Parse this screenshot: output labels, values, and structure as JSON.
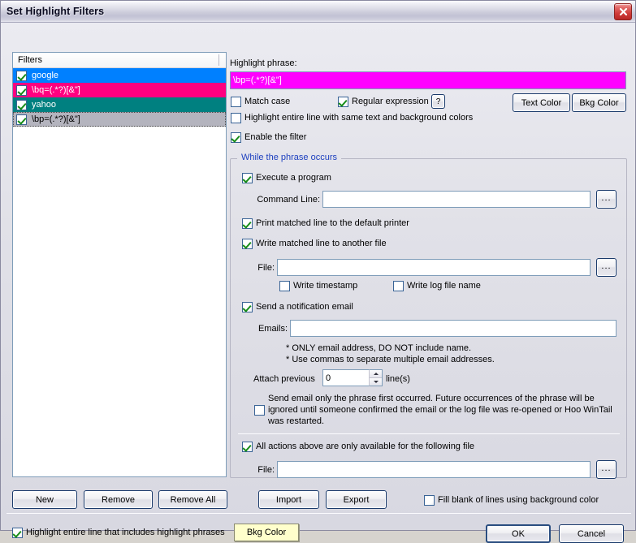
{
  "window": {
    "title": "Set Highlight Filters",
    "close_label": "×"
  },
  "filter_list": {
    "header": "Filters",
    "items": [
      {
        "label": "google",
        "checked": true,
        "bg": "#0080ff",
        "fg": "#ffffff",
        "selected": false
      },
      {
        "label": "\\bq=(.*?)[&\"]",
        "checked": true,
        "bg": "#ff0080",
        "fg": "#ffffff",
        "selected": false
      },
      {
        "label": "yahoo",
        "checked": true,
        "bg": "#008080",
        "fg": "#ffffff",
        "selected": false
      },
      {
        "label": "\\bp=(.*?)[&\"]",
        "checked": true,
        "bg": "#b4b4be",
        "fg": "#000000",
        "selected": true
      }
    ]
  },
  "list_buttons": {
    "new": "New",
    "remove": "Remove",
    "remove_all": "Remove All"
  },
  "highlight": {
    "phrase_label": "Highlight phrase:",
    "phrase_value": "\\bp=(.*?)[&\"]",
    "phrase_bg": "#ff00ff",
    "phrase_fg": "#ffffff",
    "match_case": {
      "label": "Match case",
      "checked": false
    },
    "regular_expression": {
      "label": "Regular expression",
      "checked": true
    },
    "help_button": "?",
    "text_color_button": "Text Color",
    "bkg_color_button": "Bkg Color",
    "highlight_entire_line_same": {
      "label": "Highlight entire line with same text and background colors",
      "checked": false
    },
    "enable_filter": {
      "label": "Enable the filter",
      "checked": true
    }
  },
  "while_group": {
    "title": "While the phrase occurs",
    "execute_program": {
      "label": "Execute a program",
      "checked": true
    },
    "command_line_label": "Command Line:",
    "command_line_value": "",
    "command_line_browse": "...",
    "print_matched": {
      "label": "Print matched line to the default printer",
      "checked": true
    },
    "write_matched": {
      "label": "Write matched line to another file",
      "checked": true
    },
    "write_file_label": "File:",
    "write_file_value": "",
    "write_file_browse": "...",
    "write_timestamp": {
      "label": "Write timestamp",
      "checked": false
    },
    "write_log_file_name": {
      "label": "Write log file name",
      "checked": false
    },
    "send_email": {
      "label": "Send a notification email",
      "checked": true
    },
    "emails_label": "Emails:",
    "emails_value": "",
    "email_note_1": "* ONLY email address, DO NOT include name.",
    "email_note_2": "* Use commas to separate multiple email addresses.",
    "attach_previous_label": "Attach previous",
    "attach_previous_value": "0",
    "attach_previous_suffix": "line(s)",
    "send_once": {
      "label": "Send email only the phrase first occurred. Future occurrences of the phrase will be ignored until someone confirmed the email or the log file was re-opened or Hoo WinTail was restarted.",
      "checked": false
    },
    "restrict_file": {
      "label": "All actions above are only available for the following file",
      "checked": true
    },
    "restrict_file_label": "File:",
    "restrict_file_value": "",
    "restrict_file_browse": "..."
  },
  "io_buttons": {
    "import": "Import",
    "export": "Export"
  },
  "fill_blank": {
    "label": "Fill blank of lines using background color",
    "checked": false
  },
  "footer": {
    "highlight_entire_line": {
      "label": "Highlight entire line that includes highlight phrases",
      "checked": true
    },
    "bkg_color_button": "Bkg Color",
    "ok": "OK",
    "cancel": "Cancel"
  }
}
